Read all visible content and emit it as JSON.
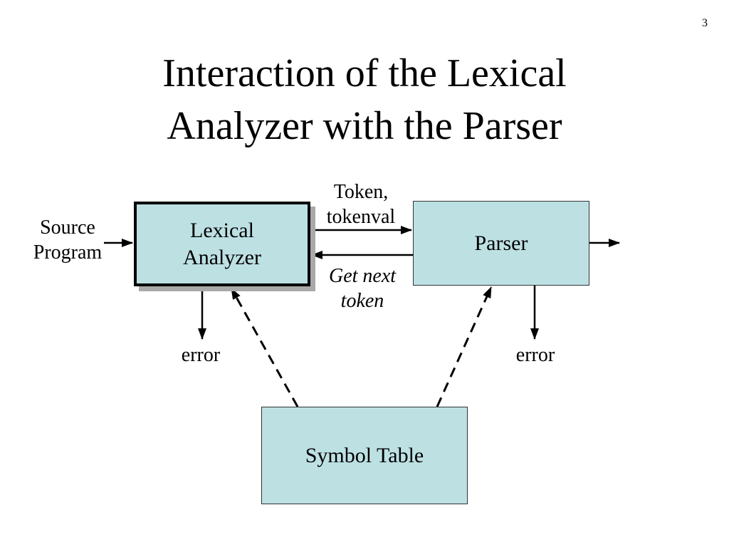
{
  "slide": {
    "page_number": "3",
    "title_lines": [
      "Interaction of the Lexical",
      "Analyzer with the Parser"
    ]
  },
  "boxes": {
    "lexer": [
      "Lexical",
      "Analyzer"
    ],
    "parser": "Parser",
    "symbol_table": "Symbol Table"
  },
  "labels": {
    "source": [
      "Source",
      "Program"
    ],
    "token": [
      "Token,",
      "tokenval"
    ],
    "get_next": [
      "Get next",
      "token"
    ],
    "error_left": "error",
    "error_right": "error"
  },
  "colors": {
    "box_fill": "#bde0e3",
    "shadow": "#a9a9a9"
  }
}
